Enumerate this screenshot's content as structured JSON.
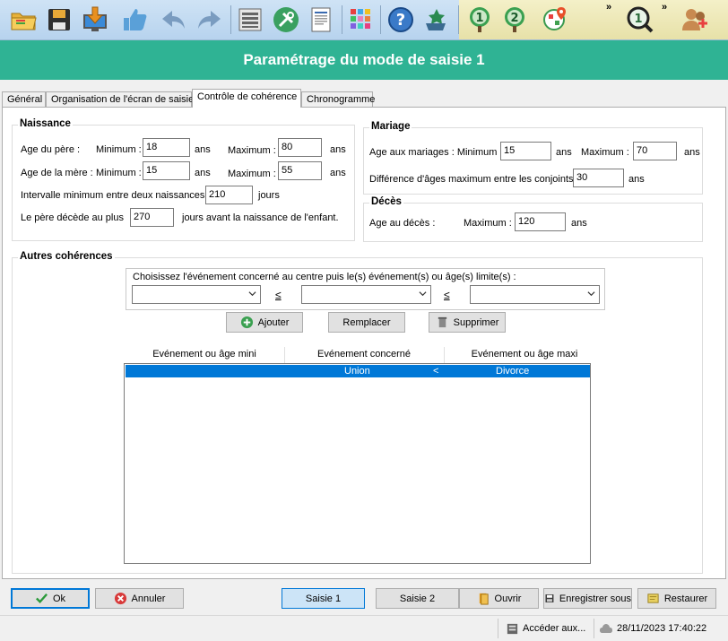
{
  "toolbar": {
    "icons": [
      "open-folder-icon",
      "save-icon",
      "import-icon",
      "thumbs-up-icon",
      "undo-icon",
      "redo-icon",
      "register-icon",
      "tools-icon",
      "document-icon",
      "color-palette-icon",
      "help-icon",
      "plant-icon",
      "tree-1-icon",
      "tree-2-icon",
      "map-pin-icon",
      "search-1-icon",
      "add-person-icon"
    ],
    "overflow_1": "»",
    "overflow_2": "»"
  },
  "window": {
    "title": "Paramétrage du mode de saisie 1"
  },
  "tabs": [
    {
      "label": "Général"
    },
    {
      "label": "Organisation de l'écran de saisie"
    },
    {
      "label": "Contrôle de cohérence"
    },
    {
      "label": "Chronogramme"
    }
  ],
  "naissance": {
    "title": "Naissance",
    "pere_label": "Age du père :",
    "mere_label": "Age de la mère :",
    "min_label": "Minimum :",
    "max_label": "Maximum :",
    "ans": "ans",
    "pere_min": "18",
    "pere_max": "80",
    "mere_min": "15",
    "mere_max": "55",
    "intervalle_label": "Intervalle minimum entre deux naissances :",
    "intervalle_value": "210",
    "jours": "jours",
    "pere_decede_label": "Le père décède au plus",
    "pere_decede_value": "270",
    "pere_decede_suffix": "jours avant la naissance de l'enfant."
  },
  "mariage": {
    "title": "Mariage",
    "age_label": "Age aux mariages : Minimum :",
    "min_value": "15",
    "ans": "ans",
    "max_label": "Maximum :",
    "max_value": "70",
    "diff_label": "Différence d'âges maximum entre les conjoints :",
    "diff_value": "30"
  },
  "deces": {
    "title": "Décès",
    "age_label": "Age au décès :",
    "max_label": "Maximum :",
    "max_value": "120",
    "ans": "ans"
  },
  "autres": {
    "title": "Autres cohérences",
    "prompt": "Choisissez l'événement concerné au centre puis le(s) événement(s) ou âge(s) limite(s) :",
    "le_1": "≤",
    "le_2": "≤",
    "combo_1": "",
    "combo_2": "",
    "combo_3": "",
    "add_label": "Ajouter",
    "replace_label": "Remplacer",
    "delete_label": "Supprimer",
    "columns": [
      "Evénement ou âge mini",
      "Evénement concerné",
      "Evénement ou âge maxi"
    ],
    "rows": [
      {
        "mini": "",
        "concerne": "Union",
        "op": "<",
        "maxi": "Divorce"
      }
    ]
  },
  "buttons": {
    "ok": "Ok",
    "cancel": "Annuler",
    "saisie1": "Saisie 1",
    "saisie2": "Saisie 2",
    "open": "Ouvrir",
    "save_as": "Enregistrer sous",
    "restore": "Restaurer"
  },
  "status": {
    "access": "Accéder aux...",
    "datetime": "28/11/2023 17:40:22"
  }
}
